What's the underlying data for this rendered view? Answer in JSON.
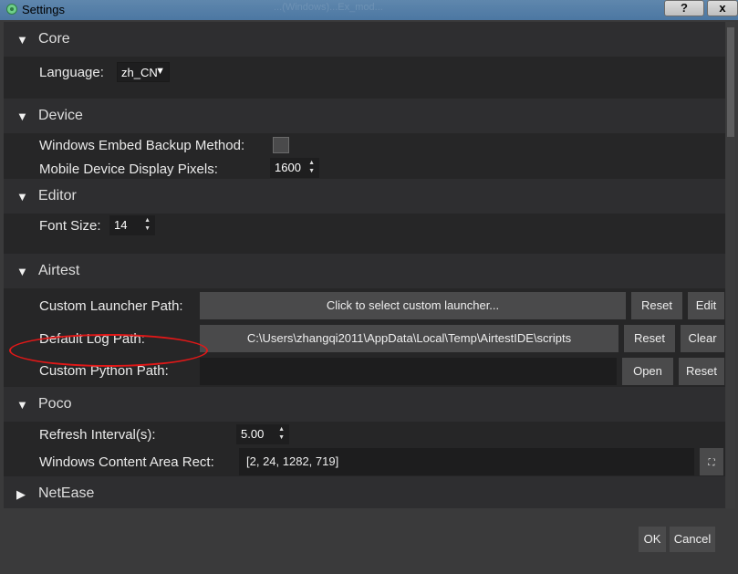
{
  "window": {
    "title": "Settings",
    "close_glyph": "x",
    "help_glyph": "?",
    "bg_text": "...(Windows)...Ex_mod..."
  },
  "sections": {
    "core": {
      "title": "Core",
      "expanded": true,
      "language_label": "Language:",
      "language_value": "zh_CN"
    },
    "device": {
      "title": "Device",
      "expanded": true,
      "embed_label": "Windows Embed Backup Method:",
      "embed_checked": false,
      "pixels_label": "Mobile Device Display Pixels:",
      "pixels_value": "1600"
    },
    "editor": {
      "title": "Editor",
      "expanded": true,
      "font_label": "Font Size:",
      "font_value": "14"
    },
    "airtest": {
      "title": "Airtest",
      "expanded": true,
      "launcher_label": "Custom Launcher Path:",
      "launcher_placeholder": "Click to select custom launcher...",
      "launcher_reset": "Reset",
      "launcher_edit": "Edit",
      "log_label": "Default Log Path:",
      "log_value": "C:\\Users\\zhangqi2011\\AppData\\Local\\Temp\\AirtestIDE\\scripts",
      "log_reset": "Reset",
      "log_clear": "Clear",
      "python_label": "Custom Python Path:",
      "python_value": "",
      "python_open": "Open",
      "python_reset": "Reset"
    },
    "poco": {
      "title": "Poco",
      "expanded": true,
      "refresh_label": "Refresh Interval(s):",
      "refresh_value": "5.00",
      "rect_label": "Windows Content Area Rect:",
      "rect_value": "[2, 24, 1282, 719]"
    },
    "netease": {
      "title": "NetEase",
      "expanded": false
    }
  },
  "footer": {
    "ok": "OK",
    "cancel": "Cancel"
  },
  "colors": {
    "highlight": "#e01818"
  },
  "icons": {
    "expanded": "triangle-down-icon",
    "collapsed": "triangle-right-icon"
  }
}
